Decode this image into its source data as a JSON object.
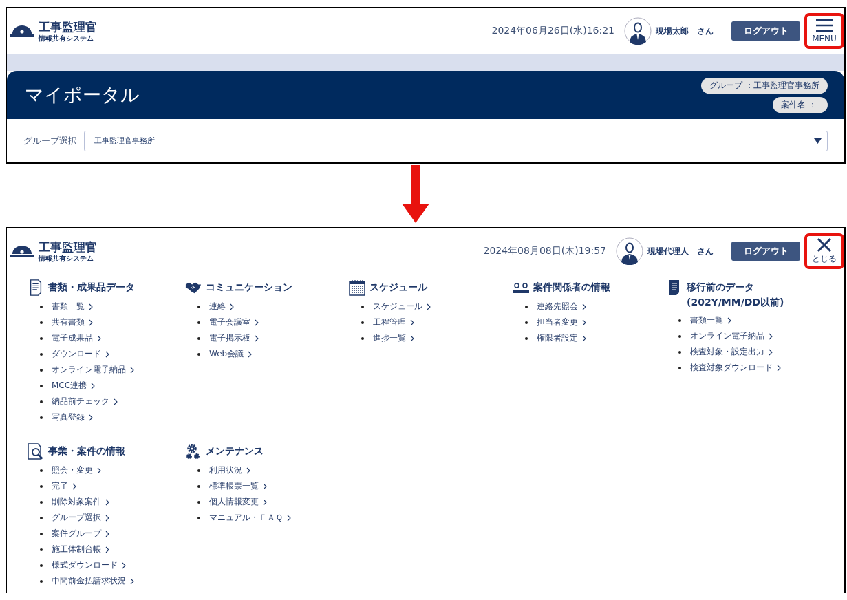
{
  "before": {
    "header": {
      "logo_title": "工事監理官",
      "logo_subtitle": "情報共有システム",
      "datetime": "2024年06月26日(水)16:21",
      "user_name": "現場太郎",
      "user_suffix": "さん",
      "logout": "ログアウト",
      "toggle": {
        "kind": "menu",
        "label": "MENU",
        "highlighted": true
      }
    },
    "portal": {
      "title": "マイポータル",
      "group_badge": "グループ ：工事監理官事務所",
      "case_badge": "案件名 ：-"
    },
    "group_select": {
      "label": "グループ選択",
      "value": "工事監理官事務所"
    }
  },
  "after": {
    "header": {
      "logo_title": "工事監理官",
      "logo_subtitle": "情報共有システム",
      "datetime": "2024年08月08日(木)19:57",
      "user_name": "現場代理人",
      "user_suffix": "さん",
      "logout": "ログアウト",
      "toggle": {
        "kind": "close",
        "label": "とじる",
        "highlighted": true
      }
    },
    "sections": [
      {
        "kind": "document",
        "title": "書類・成果品データ",
        "items": [
          "書類一覧",
          "共有書類",
          "電子成果品",
          "ダウンロード",
          "オンライン電子納品",
          "MCC連携",
          "納品前チェック",
          "写真登録"
        ]
      },
      {
        "kind": "handshake",
        "title": "コミュニケーション",
        "items": [
          "連絡",
          "電子会議室",
          "電子掲示板",
          "Web会議"
        ]
      },
      {
        "kind": "calendar",
        "title": "スケジュール",
        "items": [
          "スケジュール",
          "工程管理",
          "進捗一覧"
        ]
      },
      {
        "kind": "people",
        "title": "案件関係者の情報",
        "items": [
          "連絡先照会",
          "担当者変更",
          "権限者設定"
        ]
      },
      {
        "kind": "file",
        "title": "移行前のデータ",
        "note": "(202Y/MM/DD以前)",
        "items": [
          "書類一覧",
          "オンライン電子納品",
          "検査対象・設定出力",
          "検査対象ダウンロード"
        ]
      },
      {
        "kind": "search",
        "title": "事業・案件の情報",
        "items": [
          "照会・変更",
          "完了",
          "削除対象案件",
          "グループ選択",
          "案件グループ",
          "施工体制台帳",
          "様式ダウンロード",
          "中間前金払請求状況"
        ]
      },
      {
        "kind": "gears",
        "title": "メンテナンス",
        "items": [
          "利用状況",
          "標準帳票一覧",
          "個人情報変更",
          "マニュアル・ＦＡＱ"
        ]
      }
    ]
  }
}
